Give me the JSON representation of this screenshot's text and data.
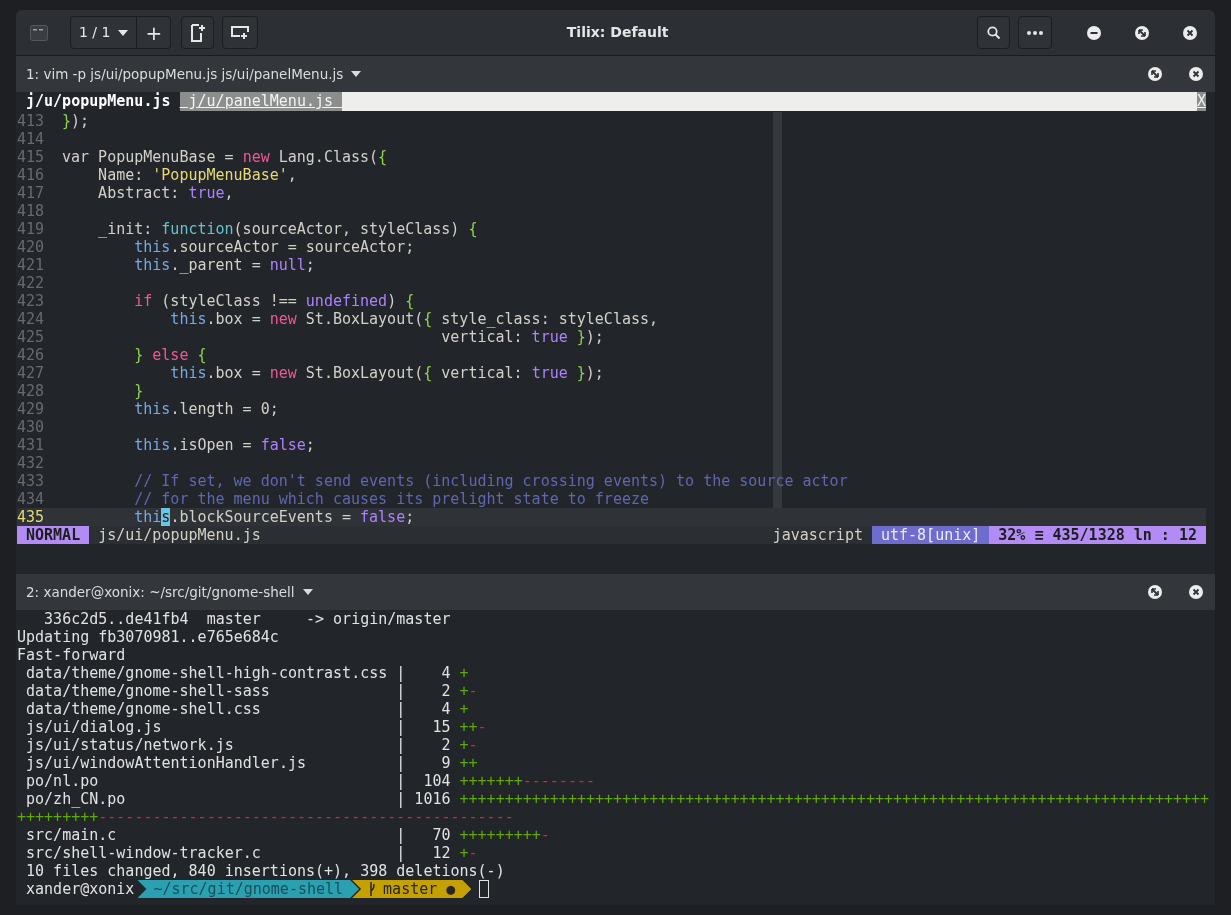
{
  "window": {
    "title": "Tilix: Default",
    "session": "1 / 1",
    "new_session": "+"
  },
  "vim_pane": {
    "title": "1: vim -p js/ui/popupMenu.js js/ui/panelMenu.js",
    "tabs": [
      {
        "label": "j/u/popupMenu.js",
        "selected": true
      },
      {
        "label": " j/u/panelMenu.js ",
        "selected": false
      }
    ],
    "close_label": "X",
    "lines": [
      {
        "number": "413",
        "current": false,
        "tokens": [
          {
            "kind": "brace",
            "text": "}"
          },
          {
            "kind": "plain",
            "text": ");"
          }
        ]
      },
      {
        "number": "414",
        "current": false
      },
      {
        "number": "415",
        "current": false,
        "tokens": [
          {
            "kind": "plain",
            "text": "var PopupMenuBase = "
          },
          {
            "kind": "keyword",
            "text": "new"
          },
          {
            "kind": "plain",
            "text": " Lang.Class("
          },
          {
            "kind": "brace",
            "text": "{"
          }
        ]
      },
      {
        "number": "416",
        "current": false,
        "tokens": [
          {
            "kind": "plain",
            "text": "    Name: "
          },
          {
            "kind": "string",
            "text": "'PopupMenuBase'"
          },
          {
            "kind": "plain",
            "text": ","
          }
        ]
      },
      {
        "number": "417",
        "current": false,
        "tokens": [
          {
            "kind": "plain",
            "text": "    Abstract: "
          },
          {
            "kind": "constant",
            "text": "true"
          },
          {
            "kind": "plain",
            "text": ","
          }
        ]
      },
      {
        "number": "418",
        "current": false
      },
      {
        "number": "419",
        "current": false,
        "tokens": [
          {
            "kind": "plain",
            "text": "    _init: "
          },
          {
            "kind": "function",
            "text": "function"
          },
          {
            "kind": "plain",
            "text": "(sourceActor, styleClass) "
          },
          {
            "kind": "brace",
            "text": "{"
          }
        ]
      },
      {
        "number": "420",
        "current": false,
        "tokens": [
          {
            "kind": "self",
            "text": "        this"
          },
          {
            "kind": "plain",
            "text": ".sourceActor = sourceActor;"
          }
        ]
      },
      {
        "number": "421",
        "current": false,
        "tokens": [
          {
            "kind": "self",
            "text": "        this"
          },
          {
            "kind": "plain",
            "text": "._parent = "
          },
          {
            "kind": "constant",
            "text": "null"
          },
          {
            "kind": "plain",
            "text": ";"
          }
        ]
      },
      {
        "number": "422",
        "current": false
      },
      {
        "number": "423",
        "current": false,
        "tokens": [
          {
            "kind": "keyword",
            "text": "        if"
          },
          {
            "kind": "plain",
            "text": " (styleClass !== "
          },
          {
            "kind": "constant",
            "text": "undefined"
          },
          {
            "kind": "plain",
            "text": ") "
          },
          {
            "kind": "brace",
            "text": "{"
          }
        ]
      },
      {
        "number": "424",
        "current": false,
        "tokens": [
          {
            "kind": "self",
            "text": "            this"
          },
          {
            "kind": "plain",
            "text": ".box = "
          },
          {
            "kind": "keyword",
            "text": "new"
          },
          {
            "kind": "plain",
            "text": " St.BoxLayout("
          },
          {
            "kind": "brace",
            "text": "{"
          },
          {
            "kind": "plain",
            "text": " style_class: styleClass,"
          }
        ]
      },
      {
        "number": "425",
        "current": false,
        "tokens": [
          {
            "kind": "plain",
            "text": "                                          vertical: "
          },
          {
            "kind": "constant",
            "text": "true"
          },
          {
            "kind": "brace",
            "text": " }"
          },
          {
            "kind": "plain",
            "text": ");"
          }
        ]
      },
      {
        "number": "426",
        "current": false,
        "tokens": [
          {
            "kind": "brace",
            "text": "        }"
          },
          {
            "kind": "keyword",
            "text": " else"
          },
          {
            "kind": "brace",
            "text": " {"
          }
        ]
      },
      {
        "number": "427",
        "current": false,
        "tokens": [
          {
            "kind": "self",
            "text": "            this"
          },
          {
            "kind": "plain",
            "text": ".box = "
          },
          {
            "kind": "keyword",
            "text": "new"
          },
          {
            "kind": "plain",
            "text": " St.BoxLayout("
          },
          {
            "kind": "brace",
            "text": "{"
          },
          {
            "kind": "plain",
            "text": " vertical: "
          },
          {
            "kind": "constant",
            "text": "true"
          },
          {
            "kind": "brace",
            "text": " }"
          },
          {
            "kind": "plain",
            "text": ");"
          }
        ]
      },
      {
        "number": "428",
        "current": false,
        "tokens": [
          {
            "kind": "brace",
            "text": "        }"
          }
        ]
      },
      {
        "number": "429",
        "current": false,
        "tokens": [
          {
            "kind": "self",
            "text": "        this"
          },
          {
            "kind": "plain",
            "text": ".length = 0;"
          }
        ]
      },
      {
        "number": "430",
        "current": false
      },
      {
        "number": "431",
        "current": false,
        "tokens": [
          {
            "kind": "self",
            "text": "        this"
          },
          {
            "kind": "plain",
            "text": ".isOpen = "
          },
          {
            "kind": "constant",
            "text": "false"
          },
          {
            "kind": "plain",
            "text": ";"
          }
        ]
      },
      {
        "number": "432",
        "current": false
      },
      {
        "number": "433",
        "current": false,
        "tokens": [
          {
            "kind": "comment",
            "text": "        // If set, we don't send events (including crossing events) to the source actor"
          }
        ]
      },
      {
        "number": "434",
        "current": false,
        "tokens": [
          {
            "kind": "comment",
            "text": "        // for the menu which causes its prelight state to freeze"
          }
        ]
      },
      {
        "number": "435",
        "current": true,
        "tokens": [
          {
            "kind": "self",
            "text": "        thi"
          },
          {
            "kind": "cursor",
            "text": "s"
          },
          {
            "kind": "plain",
            "text": ".blockSourceEvents = "
          },
          {
            "kind": "constant",
            "text": "false"
          },
          {
            "kind": "plain",
            "text": ";"
          }
        ]
      }
    ],
    "statusline": {
      "mode": "NORMAL",
      "file": "js/ui/popupMenu.js",
      "filetype": "javascript",
      "encoding": "utf-8[unix]",
      "percent": "32%",
      "lines_symbol": "≡",
      "position": "435/1328",
      "line_symbol": "ln",
      "column_separator": ":",
      "column": "12"
    }
  },
  "shell_pane": {
    "title": "2: xander@xonix: ~/src/git/gnome-shell",
    "lines": [
      [
        {
          "kind": "plain",
          "text": "   336c2d5..de41fb4  master     -> origin/master"
        }
      ],
      [
        {
          "kind": "plain",
          "text": "Updating fb3070981..e765e684c"
        }
      ],
      [
        {
          "kind": "plain",
          "text": "Fast-forward"
        }
      ],
      [
        {
          "kind": "plain",
          "text": " data/theme/gnome-shell-high-contrast.css |    4 "
        },
        {
          "kind": "add",
          "text": "+"
        }
      ],
      [
        {
          "kind": "plain",
          "text": " data/theme/gnome-shell-sass              |    2 "
        },
        {
          "kind": "add",
          "text": "+"
        },
        {
          "kind": "del",
          "text": "-"
        }
      ],
      [
        {
          "kind": "plain",
          "text": " data/theme/gnome-shell.css               |    4 "
        },
        {
          "kind": "add",
          "text": "+"
        }
      ],
      [
        {
          "kind": "plain",
          "text": " js/ui/dialog.js                          |   15 "
        },
        {
          "kind": "add",
          "text": "++"
        },
        {
          "kind": "del",
          "text": "-"
        }
      ],
      [
        {
          "kind": "plain",
          "text": " js/ui/status/network.js                  |    2 "
        },
        {
          "kind": "add",
          "text": "+"
        },
        {
          "kind": "del",
          "text": "-"
        }
      ],
      [
        {
          "kind": "plain",
          "text": " js/ui/windowAttentionHandler.js          |    9 "
        },
        {
          "kind": "add",
          "text": "++"
        }
      ],
      [
        {
          "kind": "plain",
          "text": " po/nl.po                                 |  104 "
        },
        {
          "kind": "add",
          "text": "+++++++"
        },
        {
          "kind": "del",
          "text": "--------"
        }
      ],
      [
        {
          "kind": "plain",
          "text": " po/zh_CN.po                              | 1016 "
        },
        {
          "kind": "add",
          "text": "+++++++++++++++++++++++++++++++++++++++++++++++++++++++++++++++++++++++++++++++++++"
        }
      ],
      [
        {
          "kind": "add",
          "text": "+++++++++"
        },
        {
          "kind": "del",
          "text": "----------------------------------------------"
        }
      ],
      [
        {
          "kind": "plain",
          "text": " src/main.c                               |   70 "
        },
        {
          "kind": "add",
          "text": "+++++++++"
        },
        {
          "kind": "del",
          "text": "-"
        }
      ],
      [
        {
          "kind": "plain",
          "text": " src/shell-window-tracker.c               |   12 "
        },
        {
          "kind": "add",
          "text": "+"
        },
        {
          "kind": "del",
          "text": "-"
        }
      ],
      [
        {
          "kind": "plain",
          "text": " 10 files changed, 840 insertions(+), 398 deletions(-)"
        }
      ]
    ],
    "prompt": {
      "user": "xander@xonix",
      "path": "~/src/git/gnome-shell",
      "branch": "master",
      "dirty_mark": "●"
    }
  }
}
